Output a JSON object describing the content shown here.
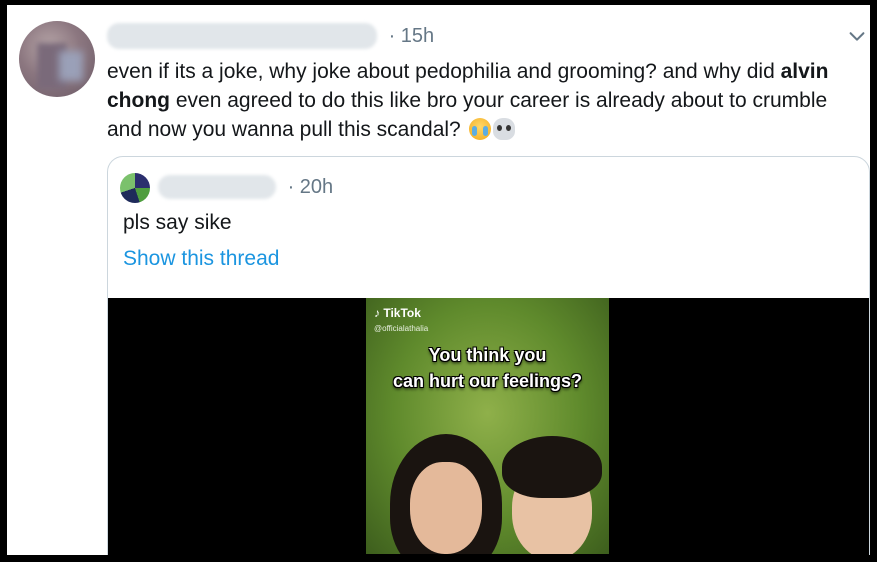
{
  "tweet": {
    "time": "· 15h",
    "text_before": "even if its a joke, why joke about pedophilia and grooming? and why did ",
    "text_bold": "alvin chong",
    "text_after": " even agreed to do this like bro your career is already about to crumble and now you wanna pull this scandal? ",
    "emoji": [
      "loudly-crying-face",
      "skull"
    ]
  },
  "quoted_tweet": {
    "time": "· 20h",
    "text": "pls say sike",
    "link_label": "Show this thread"
  },
  "video": {
    "brand": "TikTok",
    "username": "@officialathalia",
    "caption_line1": "You think you",
    "caption_line2": "can hurt our feelings?"
  },
  "icons": {
    "menu": "chevron-down-icon",
    "brand": "tiktok-icon"
  },
  "colors": {
    "link": "#1b95e0",
    "secondary_text": "#657786",
    "border": "#ccd6dd"
  }
}
